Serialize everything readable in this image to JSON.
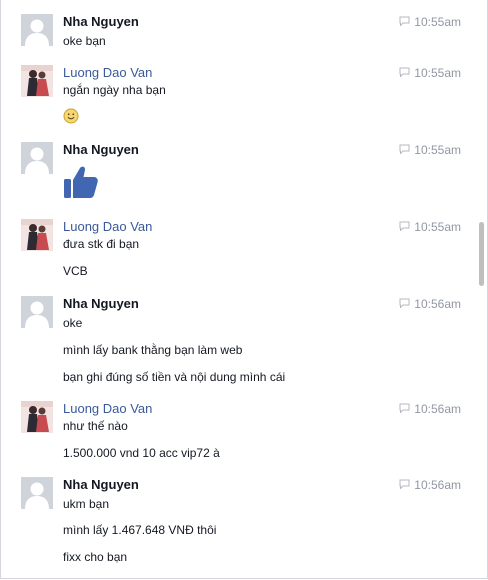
{
  "thread": {
    "messages": [
      {
        "sender": "Nha Nguyen",
        "time": "10:55am",
        "avatar": "default",
        "lines": [
          "oke bạn"
        ]
      },
      {
        "sender": "Luong Dao Van",
        "time": "10:55am",
        "avatar": "photo",
        "lines": [
          "ngắn ngày nha bạn"
        ],
        "emoji": "smiley-emoji-icon"
      },
      {
        "sender": "Nha Nguyen",
        "time": "10:55am",
        "avatar": "default",
        "sticker": "thumbs-up-icon",
        "accent": "#4267b2"
      },
      {
        "sender": "Luong Dao Van",
        "time": "10:55am",
        "avatar": "photo",
        "lines": [
          "đưa stk đi bạn",
          "VCB"
        ]
      },
      {
        "sender": "Nha Nguyen",
        "time": "10:56am",
        "avatar": "default",
        "lines": [
          "oke",
          "mình lấy bank thằng bạn làm web",
          "bạn ghi đúng số tiền và nội dung mình cái"
        ]
      },
      {
        "sender": "Luong Dao Van",
        "time": "10:56am",
        "avatar": "photo",
        "lines": [
          "như thế nào",
          "1.500.000 vnd 10 acc vip72 à"
        ]
      },
      {
        "sender": "Nha Nguyen",
        "time": "10:56am",
        "avatar": "default",
        "lines": [
          "ukm bạn",
          "mình lấy 1.467.648 VNĐ thôi",
          "fixx cho bạn"
        ]
      }
    ]
  }
}
